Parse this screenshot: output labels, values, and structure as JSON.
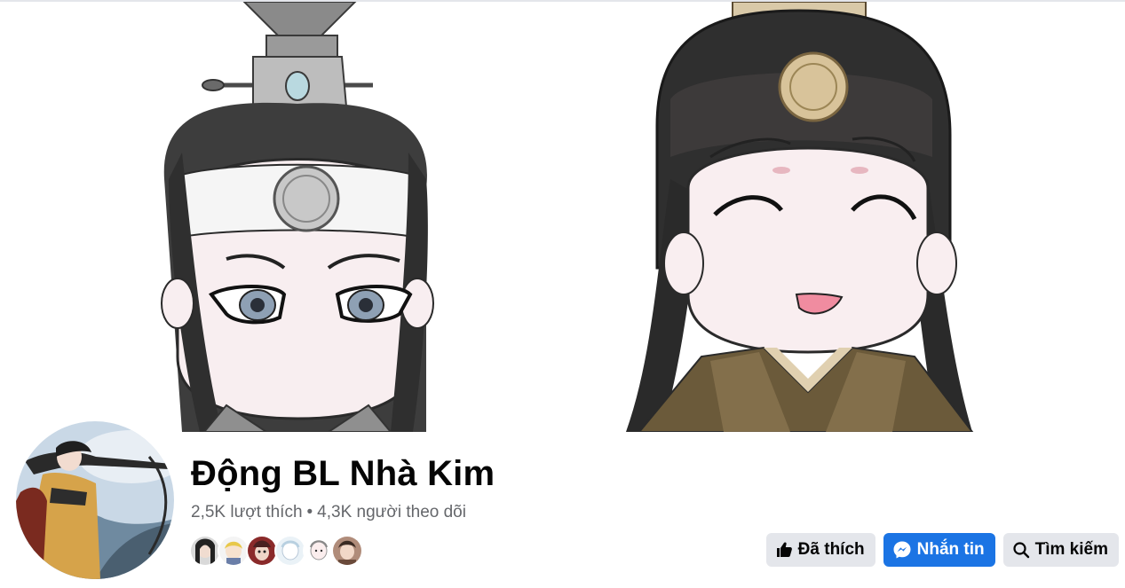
{
  "page": {
    "name": "Động BL Nhà Kim",
    "likes": "2,5K lượt thích",
    "separator": "•",
    "followers": "4,3K người theo dõi"
  },
  "actions": {
    "liked_label": "Đã thích",
    "message_label": "Nhắn tin",
    "search_label": "Tìm kiếm"
  },
  "icons": {
    "liked": "thumbs-up-icon",
    "message": "messenger-icon",
    "search": "search-icon"
  },
  "friends_count_shown": 6,
  "colors": {
    "primary_button": "#1b74e4",
    "secondary_button": "#e4e6eb",
    "title": "#050505",
    "secondary_text": "#65676b"
  }
}
